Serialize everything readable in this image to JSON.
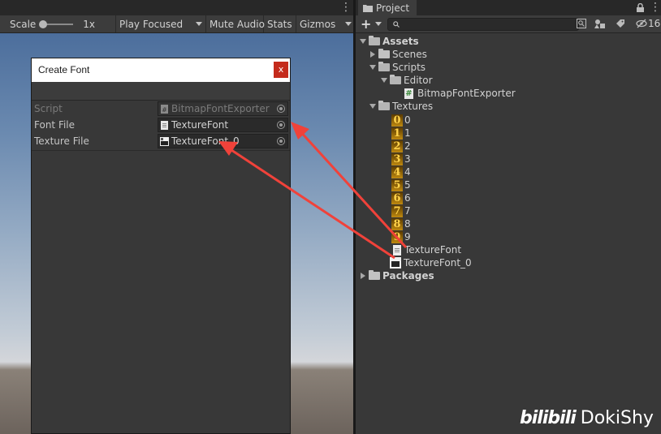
{
  "game_toolbar": {
    "scale_label": "Scale",
    "scale_value": "1x",
    "play_mode": "Play Focused",
    "mute_audio": "Mute Audio",
    "stats": "Stats",
    "gizmos": "Gizmos"
  },
  "create_font": {
    "title": "Create Font",
    "close_glyph": "x",
    "fields": [
      {
        "label": "Script",
        "value": "BitmapFontExporter"
      },
      {
        "label": "Font File",
        "value": "TextureFont"
      },
      {
        "label": "Texture File",
        "value": "TextureFont_0"
      }
    ]
  },
  "project": {
    "tab_label": "Project",
    "add_glyph": "+",
    "hidden_count": "16",
    "tree": {
      "assets": "Assets",
      "scenes": "Scenes",
      "scripts": "Scripts",
      "editor": "Editor",
      "exporter_script": "BitmapFontExporter",
      "textures": "Textures",
      "digits": [
        "0",
        "1",
        "2",
        "3",
        "4",
        "5",
        "6",
        "7",
        "8",
        "9"
      ],
      "texture_font": "TextureFont",
      "texture_font_0": "TextureFont_0",
      "packages": "Packages"
    }
  },
  "watermark": {
    "logo": "bilibili",
    "author": "DokiShy"
  },
  "colors": {
    "arrow": "#f0423a",
    "close_button": "#c42b1c"
  }
}
